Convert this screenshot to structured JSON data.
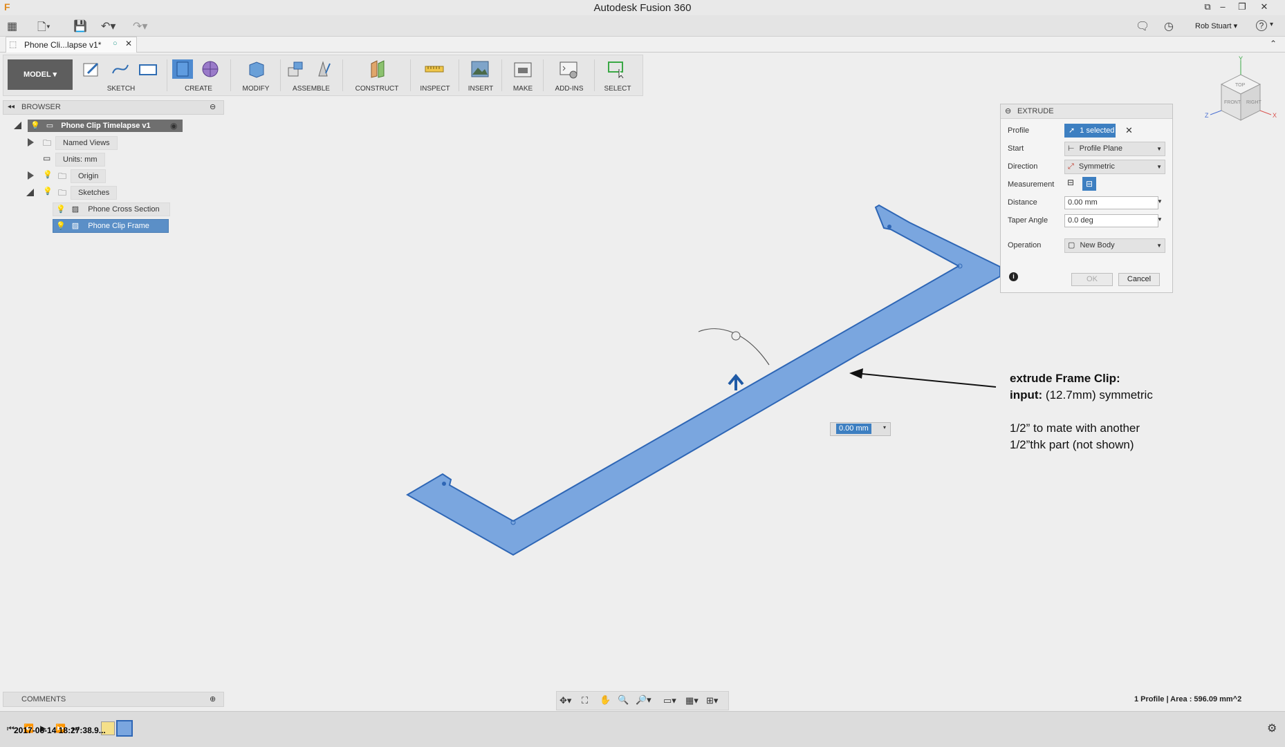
{
  "app": {
    "title": "Autodesk Fusion 360",
    "user": "Rob Stuart",
    "help": "?"
  },
  "tab": {
    "label": "Phone Cli...lapse v1*"
  },
  "toolbar": {
    "workspace": "MODEL",
    "groups": [
      "SKETCH",
      "CREATE",
      "MODIFY",
      "ASSEMBLE",
      "CONSTRUCT",
      "INSPECT",
      "INSERT",
      "MAKE",
      "ADD-INS",
      "SELECT"
    ]
  },
  "browser": {
    "title": "BROWSER",
    "root": "Phone Clip Timelapse v1",
    "items": [
      {
        "label": "Named Views"
      },
      {
        "label": "Units: mm"
      },
      {
        "label": "Origin"
      },
      {
        "label": "Sketches"
      },
      {
        "label": "Phone Cross Section"
      },
      {
        "label": "Phone Clip Frame"
      }
    ]
  },
  "comments": {
    "title": "COMMENTS"
  },
  "extrude": {
    "title": "EXTRUDE",
    "rows": {
      "profile_label": "Profile",
      "profile_value": "1 selected",
      "start_label": "Start",
      "start_value": "Profile Plane",
      "direction_label": "Direction",
      "direction_value": "Symmetric",
      "measurement_label": "Measurement",
      "distance_label": "Distance",
      "distance_value": "0.00 mm",
      "taper_label": "Taper Angle",
      "taper_value": "0.0 deg",
      "operation_label": "Operation",
      "operation_value": "New Body"
    },
    "ok": "OK",
    "cancel": "Cancel"
  },
  "canvas": {
    "distance_input": "0.00 mm"
  },
  "annotation": {
    "line1_bold": "extrude Frame Clip:",
    "line2_bold": "input:",
    "line2_rest": " (12.7mm) symmetric",
    "line3": "1/2” to mate with another",
    "line4": "1/2”thk part (not shown)"
  },
  "status": {
    "text": "1 Profile | Area : 596.09 mm^2"
  },
  "timeline": {
    "timestamp": "2017-06-14 18:27:38.9..."
  },
  "viewcube": {
    "top": "TOP",
    "front": "FRONT",
    "right": "RIGHT",
    "x": "X",
    "y": "Y",
    "z": "Z"
  },
  "colors": {
    "accent": "#3d7fc1",
    "profile_fill": "#7aa6df",
    "profile_stroke": "#2e66b5",
    "selected_bg": "#5b8fc7"
  }
}
